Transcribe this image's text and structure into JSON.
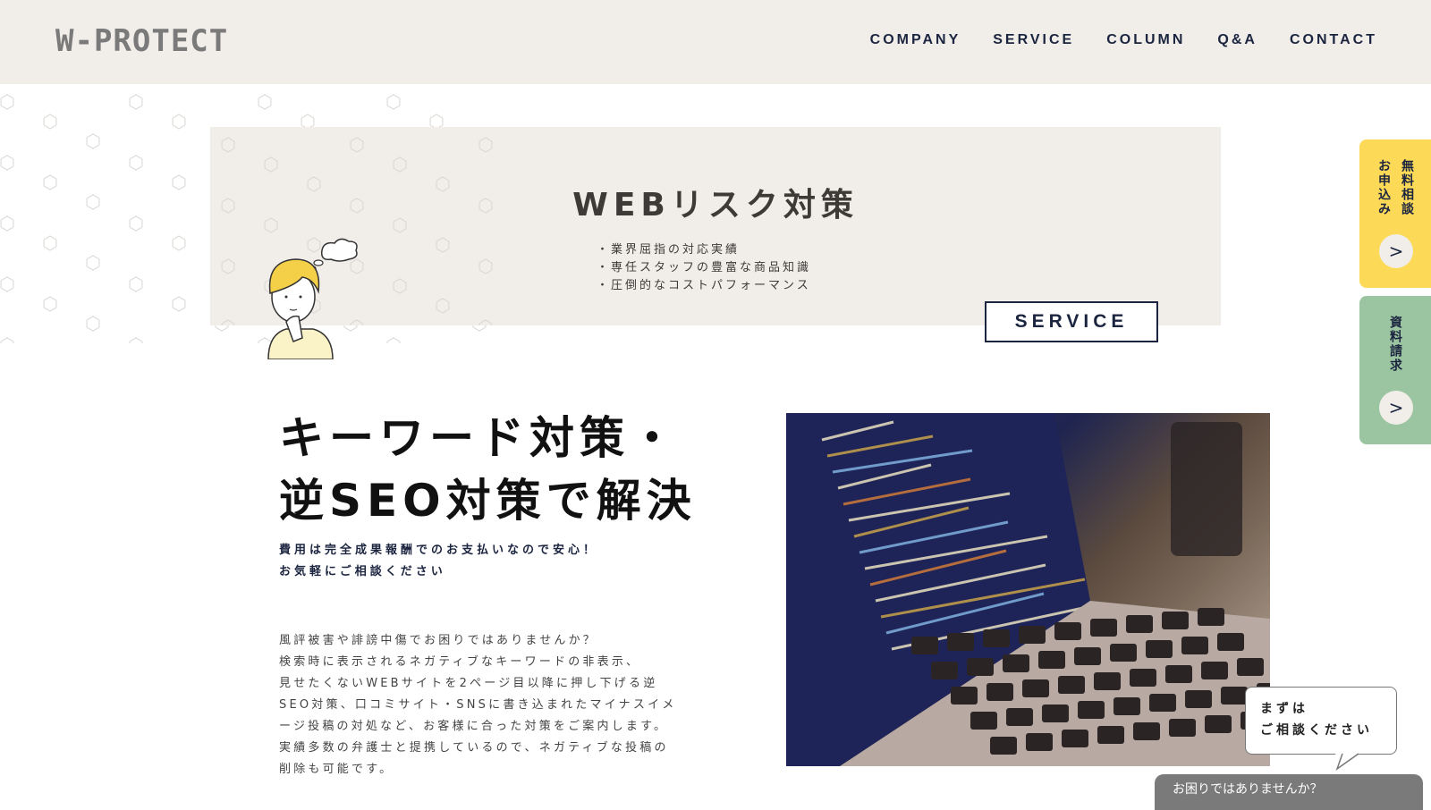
{
  "header": {
    "logo": "W-PROTECT",
    "nav": [
      "COMPANY",
      "SERVICE",
      "COLUMN",
      "Q&A",
      "CONTACT"
    ]
  },
  "hero": {
    "title": "WEBリスク対策",
    "points": [
      "・業界屈指の対応実績",
      "・専任スタッフの豊富な商品知識",
      "・圧倒的なコストパフォーマンス"
    ],
    "button_label": "SERVICE"
  },
  "main": {
    "heading_line1": "キーワード対策・",
    "heading_line2": "逆SEO対策で解決",
    "sub_line1": "費用は完全成果報酬でのお支払いなので安心！",
    "sub_line2": "お気軽にご相談ください",
    "body_lines": [
      "風評被害や誹謗中傷でお困りではありませんか？",
      "検索時に表示されるネガティブなキーワードの非表示、",
      "見せたくないWEBサイトを2ページ目以降に押し下げる逆",
      "SEO対策、口コミサイト・SNSに書き込まれたマイナスイメ",
      "ージ投稿の対処など、お客様に合った対策をご案内します。",
      "実績多数の弁護士と提携しているので、ネガティブな投稿の",
      "削除も可能です。"
    ],
    "image_alt": "laptop-with-code"
  },
  "side_tabs": {
    "consult_col1": "無料相談",
    "consult_col2": "お申込み",
    "consult_arrow": ">",
    "docs": "資料請求",
    "docs_arrow": ">",
    "colors": {
      "consult": "#fcd957",
      "docs": "#9bc5a0"
    }
  },
  "chat": {
    "bubble_line1": "まずは",
    "bubble_line2": "ご相談ください",
    "bar_label": "お困りではありませんか？"
  },
  "colors": {
    "navy": "#1c2540",
    "beige": "#f1eeea"
  }
}
